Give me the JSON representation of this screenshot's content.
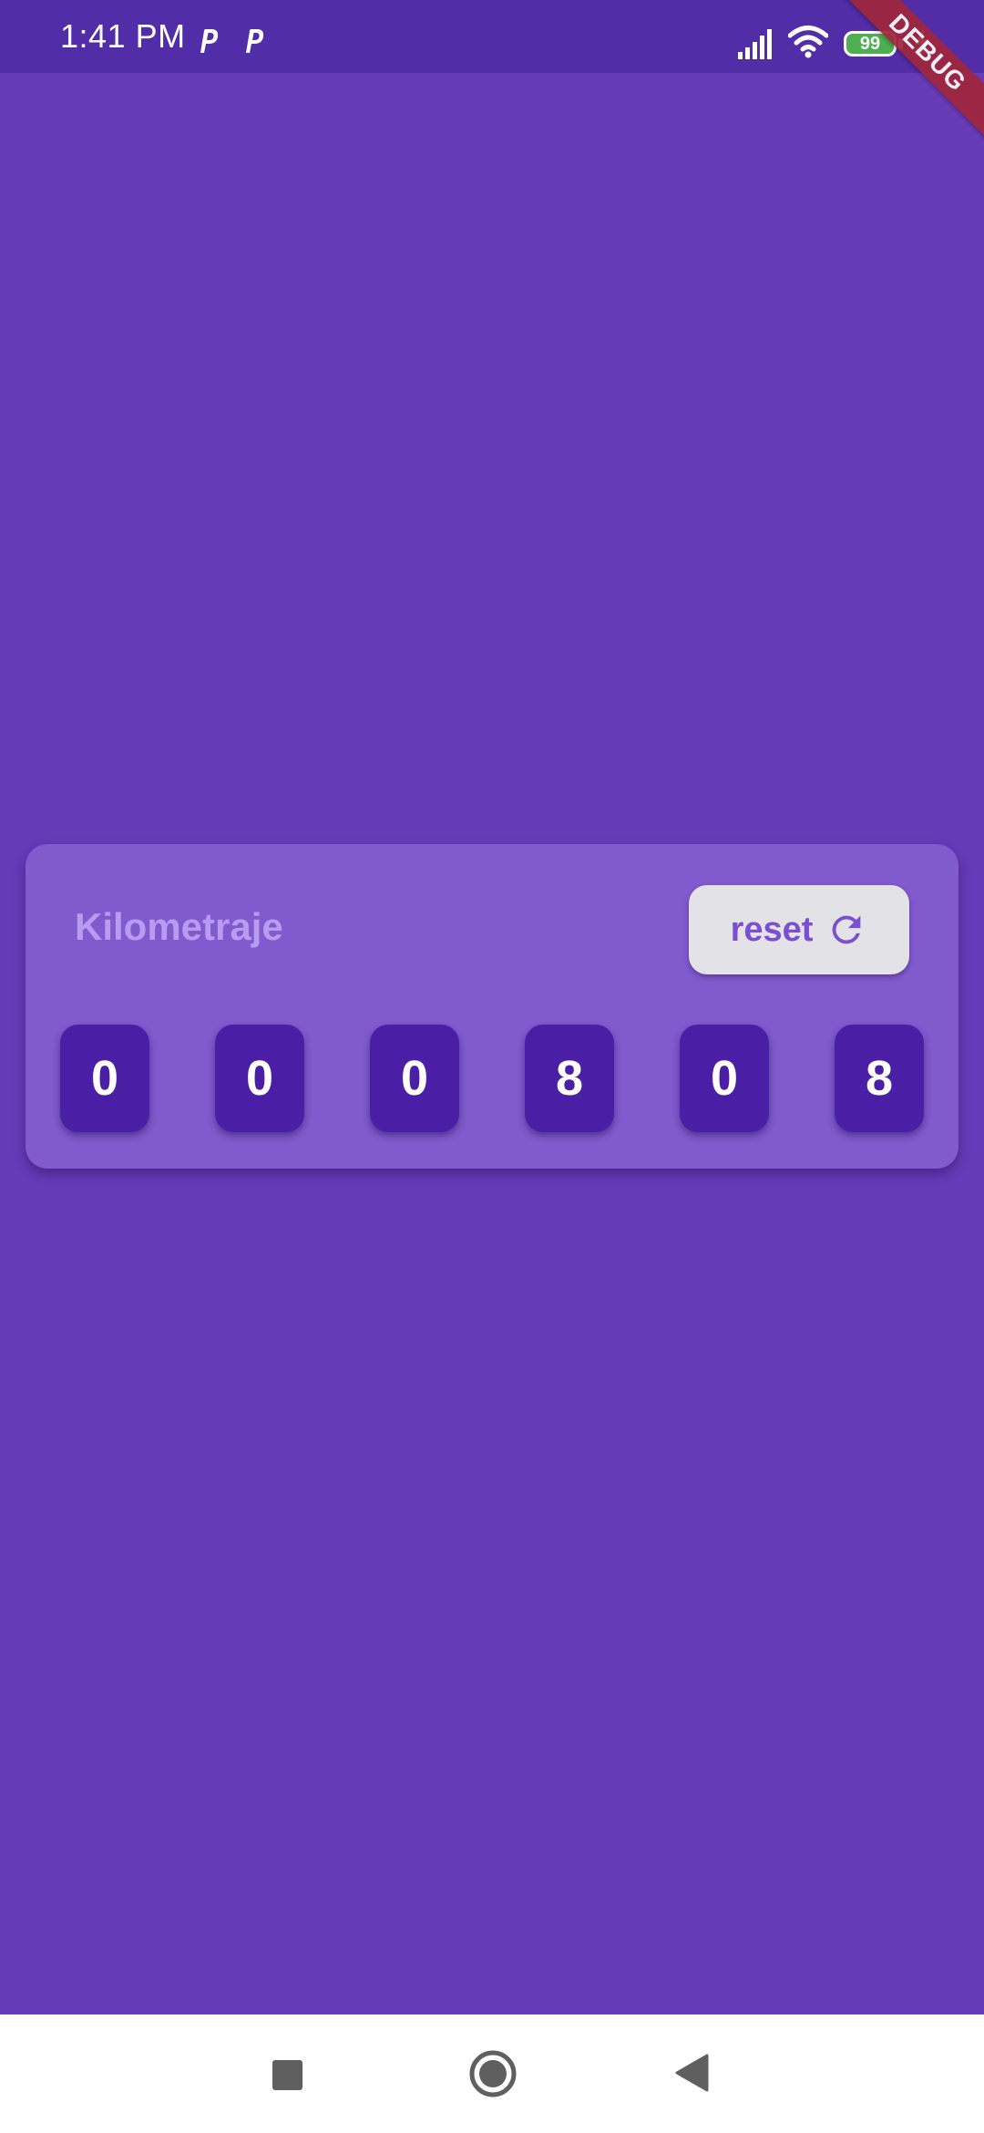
{
  "status_bar": {
    "time": "1:41 PM",
    "notification_icons": [
      "p-app-icon",
      "p-app-icon"
    ],
    "battery_level": "99",
    "icons": [
      "signal-icon",
      "wifi-icon",
      "battery-icon",
      "charging-icon"
    ]
  },
  "debug_banner": {
    "label": "DEBUG"
  },
  "card": {
    "title": "Kilometraje",
    "reset_label": "reset",
    "reset_icon": "refresh-icon",
    "digits": [
      "0",
      "0",
      "0",
      "8",
      "0",
      "8"
    ]
  },
  "nav_bar": {
    "icons": [
      "recents-icon",
      "home-icon",
      "back-icon"
    ]
  },
  "colors": {
    "background": "#673ab7",
    "status_bar": "#512da8",
    "card": "#815acd",
    "digit_box": "#4a1fa6",
    "title": "#b79cf0",
    "reset_button": "#e3e2e6",
    "reset_text": "#7b4fd0",
    "debug_ribbon": "#a0263b",
    "battery_fill": "#4caf50"
  }
}
